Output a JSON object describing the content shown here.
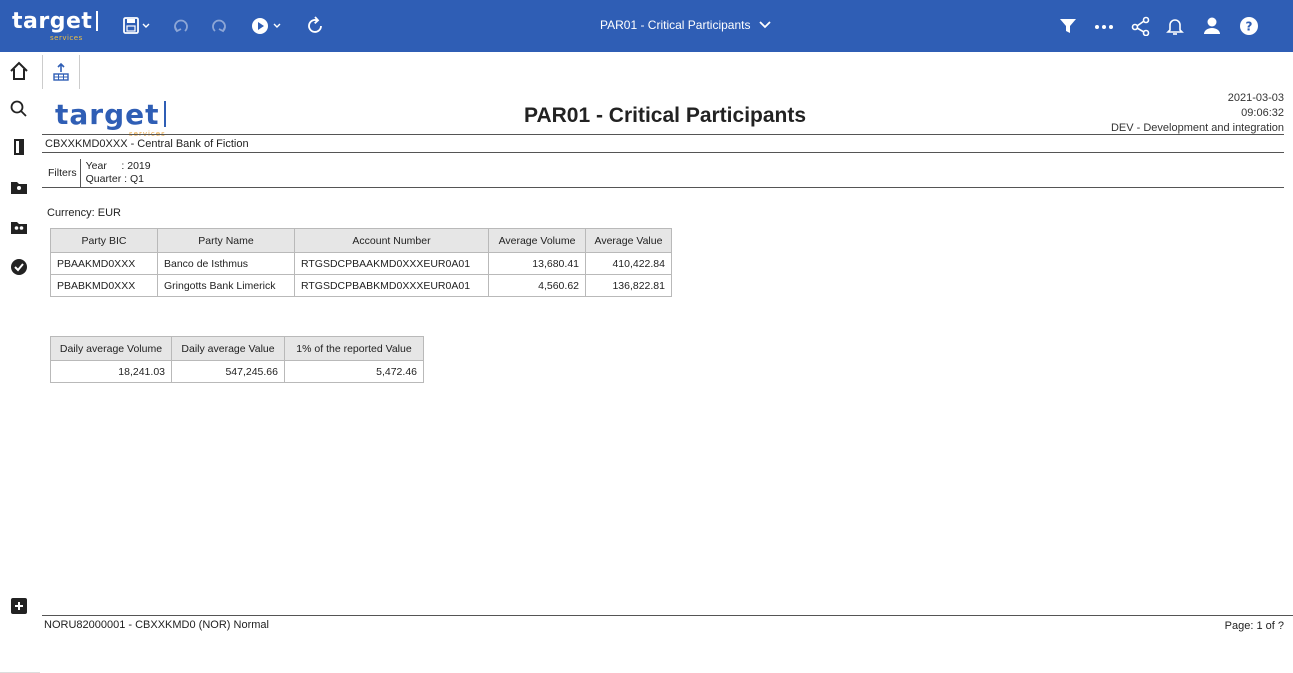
{
  "topbar": {
    "brand": "target",
    "brand_sub": "services",
    "report_dropdown": "PAR01 - Critical Participants"
  },
  "report": {
    "logo": "target",
    "logo_sub": "services",
    "title": "PAR01 - Critical Participants",
    "date": "2021-03-03",
    "time": "09:06:32",
    "environment": "DEV - Development and integration",
    "central_bank": "CBXXKMD0XXX - Central Bank of Fiction",
    "filters_label": "Filters",
    "filter_year": "Year     : 2019",
    "filter_quarter": "Quarter : Q1",
    "currency": "Currency: EUR"
  },
  "participants_table": {
    "headers": [
      "Party BIC",
      "Party Name",
      "Account Number",
      "Average Volume",
      "Average Value"
    ],
    "rows": [
      [
        "PBAAKMD0XXX",
        "Banco de Isthmus",
        "RTGSDCPBAAKMD0XXXEUR0A01",
        "13,680.41",
        "410,422.84"
      ],
      [
        "PBABKMD0XXX",
        "Gringotts Bank Limerick",
        "RTGSDCPBABKMD0XXXEUR0A01",
        "4,560.62",
        "136,822.81"
      ]
    ]
  },
  "summary_table": {
    "headers": [
      "Daily average Volume",
      "Daily average Value",
      "1% of the reported Value"
    ],
    "rows": [
      [
        "18,241.03",
        "547,245.66",
        "5,472.46"
      ]
    ]
  },
  "footer": {
    "left": "NORU82000001 - CBXXKMD0 (NOR) Normal",
    "right": "Page: 1 of ?"
  }
}
